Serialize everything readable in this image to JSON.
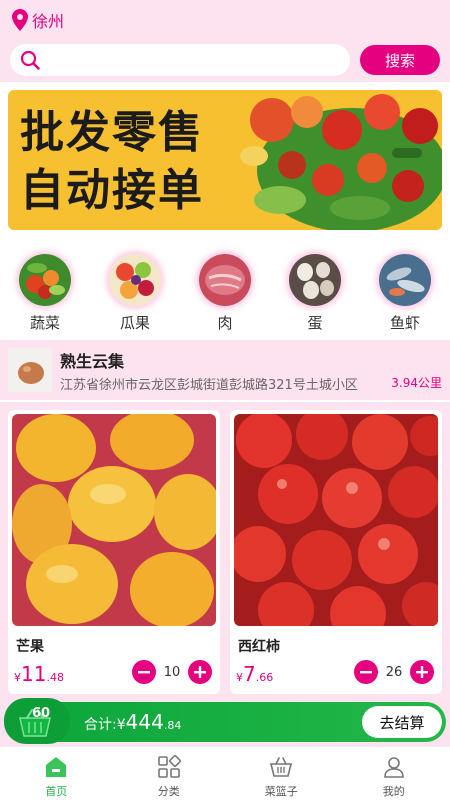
{
  "location": {
    "city": "徐州"
  },
  "search": {
    "placeholder": "",
    "button_label": "搜索"
  },
  "banner": {
    "line1": "批发零售",
    "line2": "自动接单"
  },
  "categories": [
    {
      "label": "蔬菜",
      "icon": "vegetables-image"
    },
    {
      "label": "瓜果",
      "icon": "fruits-image"
    },
    {
      "label": "肉",
      "icon": "meat-image"
    },
    {
      "label": "蛋",
      "icon": "eggs-image"
    },
    {
      "label": "鱼虾",
      "icon": "seafood-image"
    }
  ],
  "shop": {
    "name": "熟生云集",
    "address": "江苏省徐州市云龙区彭城街道彭城路321号土城小区",
    "distance": "3.94公里"
  },
  "products": [
    {
      "name": "芒果",
      "currency": "¥",
      "price_int": "11",
      "price_dec": ".48",
      "qty": "10"
    },
    {
      "name": "西红柿",
      "currency": "¥",
      "price_int": "7",
      "price_dec": ".66",
      "qty": "26"
    }
  ],
  "cart": {
    "count": "60",
    "total_label": "合计:",
    "currency": "¥",
    "total_int": "444",
    "total_dec": ".84",
    "checkout_label": "去结算"
  },
  "tabs": [
    {
      "label": "首页",
      "active": true
    },
    {
      "label": "分类",
      "active": false
    },
    {
      "label": "菜篮子",
      "active": false
    },
    {
      "label": "我的",
      "active": false
    }
  ],
  "colors": {
    "accent": "#e4007f",
    "background": "#fde3ef",
    "green": "#26b34a"
  }
}
